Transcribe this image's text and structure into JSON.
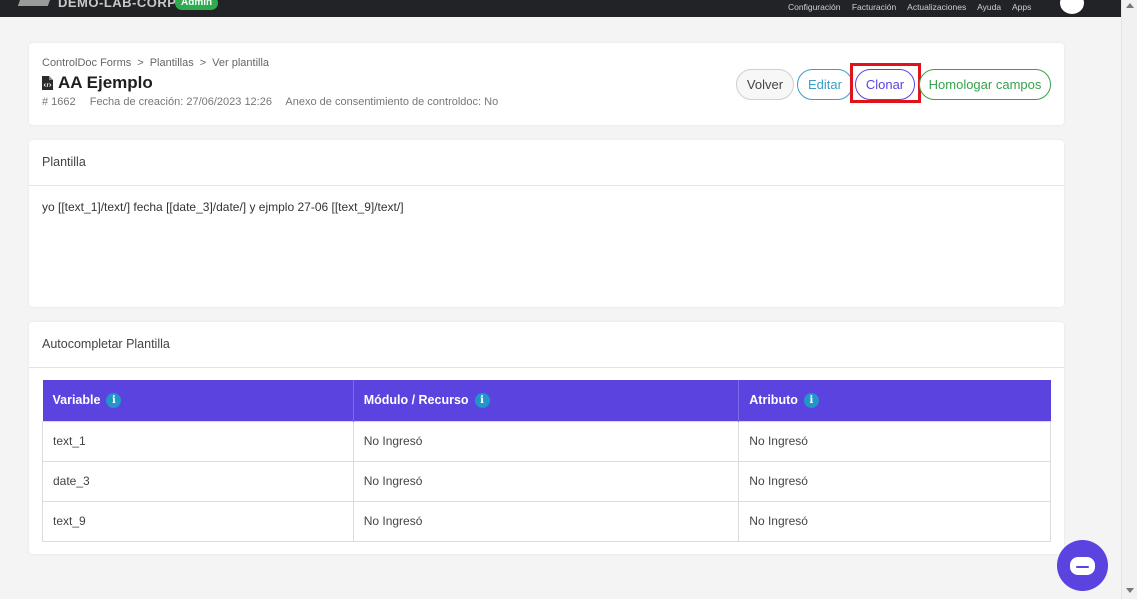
{
  "topbar": {
    "org_name": "DEMO-LAB-CORP",
    "role_badge": "Admin",
    "nav": [
      "Configuración",
      "Facturación",
      "Actualizaciones",
      "Ayuda",
      "Apps"
    ]
  },
  "breadcrumb": [
    "ControlDoc Forms",
    "Plantillas",
    "Ver plantilla"
  ],
  "breadcrumb_sep": ">",
  "page": {
    "title": "AA Ejemplo",
    "id": "# 1662",
    "created": "Fecha de creación: 27/06/2023 12:26",
    "consent": "Anexo de consentimiento de controldoc: No"
  },
  "actions": {
    "back": "Volver",
    "edit": "Editar",
    "clone": "Clonar",
    "homolog": "Homologar campos"
  },
  "template_section": {
    "heading": "Plantilla",
    "body": "yo [[text_1]/text/] fecha [[date_3]/date/] y ejmplo 27-06 [[text_9]/text/]"
  },
  "autocomplete_section": {
    "heading": "Autocompletar Plantilla",
    "columns": [
      "Variable",
      "Módulo / Recurso",
      "Atributo"
    ],
    "rows": [
      [
        "text_1",
        "No Ingresó",
        "No Ingresó"
      ],
      [
        "date_3",
        "No Ingresó",
        "No Ingresó"
      ],
      [
        "text_9",
        "No Ingresó",
        "No Ingresó"
      ]
    ]
  },
  "info_glyph": "i",
  "colors": {
    "accent": "#5b43e0",
    "edit": "#3a9ec7",
    "homolog": "#37a24b",
    "highlight": "#e0121a",
    "topbar": "#222326"
  },
  "icons": [
    "file-code-icon",
    "info-icon",
    "chat-icon"
  ]
}
